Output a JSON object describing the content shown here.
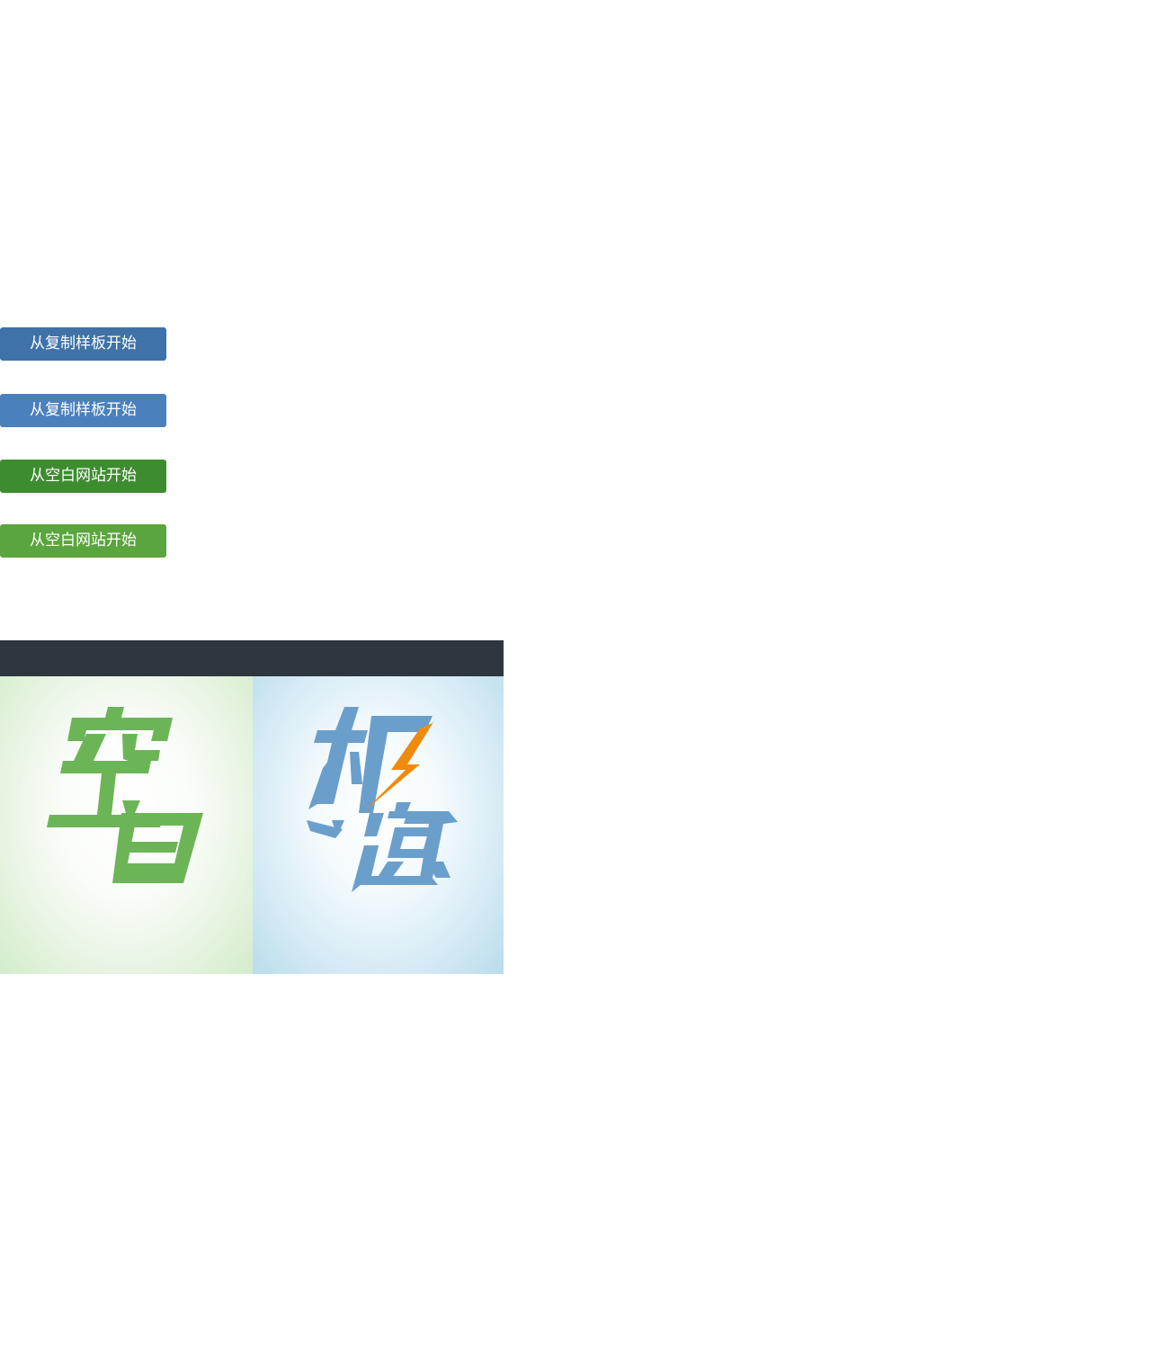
{
  "buttons": {
    "start_from_template": "从复制样板开始",
    "start_from_template_hover": "从复制样板开始",
    "start_from_blank": "从空白网站开始",
    "start_from_blank_hover": "从空白网站开始"
  },
  "tiles": {
    "blank_logo_text": "空白",
    "speed_logo_text": "极速"
  },
  "colors": {
    "template_button": "#3e72a8",
    "template_button_hover": "#4a80bc",
    "blank_button": "#3d8c2f",
    "blank_button_hover": "#5aa53d",
    "panel_bar": "#2e3640",
    "blank_logo": "#6cb556",
    "speed_logo": "#6a9fcb",
    "bolt": "#f08a0c"
  },
  "icons": {
    "speed_tile": "lightning-bolt-icon"
  }
}
